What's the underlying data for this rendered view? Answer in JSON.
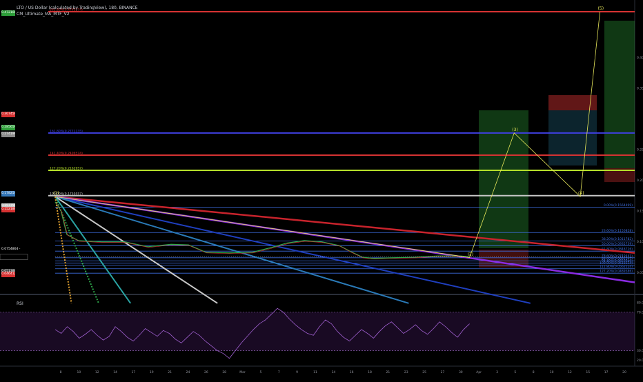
{
  "chart_header": {
    "symbol_line": "LTO / US Dollar (calculated by TradingView), 180, BINANCE",
    "indicator_line": "CM_Ultimate_MA_MTF_V2"
  },
  "rsi_pane": {
    "title": "RSI"
  },
  "price_badges": [
    {
      "text": "0.4721083",
      "color": "#2e9e3a",
      "y": 0.4721083
    },
    {
      "text": "0.3074595",
      "color": "#d63232",
      "y": 0.3074595
    },
    {
      "text": "0.2856595",
      "color": "#2e9e3a",
      "y": 0.2856595
    },
    {
      "text": "0.2741995",
      "color": "#8a8a8a",
      "y": 0.2741995
    },
    {
      "text": "0.1782549",
      "color": "#3577b8",
      "y": 0.1782549
    },
    {
      "text": "0.1577554",
      "color": "#c8c8c8",
      "y": 0.1577554
    },
    {
      "text": "0.1521864",
      "color": "#d63232",
      "y": 0.1521864
    },
    {
      "text": "0.0513867",
      "color": "#3a3a3a",
      "y": 0.0513867
    },
    {
      "text": "0.0464122",
      "color": "#d63232",
      "y": 0.0464122
    }
  ],
  "current_price_label": "0.0754864 -",
  "chart_data": [
    {
      "type": "line",
      "name": "price",
      "y_ticks": [
        "0.4000000",
        "0.3500000",
        "0.2500000",
        "0.2000000",
        "0.1500000",
        "0.1000000",
        "0.0500000"
      ],
      "y_tick_values": [
        0.4,
        0.35,
        0.25,
        0.2,
        0.15,
        0.1,
        0.05
      ],
      "x_ticks": [
        "8",
        "10",
        "12",
        "14",
        "17",
        "19",
        "21",
        "24",
        "26",
        "28",
        "Mar",
        "5",
        "7",
        "9",
        "11",
        "14",
        "16",
        "18",
        "21",
        "23",
        "25",
        "27",
        "30",
        "Apr",
        "3",
        "5",
        "8",
        "10",
        "12",
        "15",
        "17",
        "20"
      ],
      "ylim": [
        0.02,
        0.48
      ],
      "fib_levels": [
        {
          "label": "261.80%(0.4743274)",
          "value": 0.4743274,
          "color": "#d63232"
        },
        {
          "label": "161.80%(0.2771135)",
          "value": 0.2771135,
          "color": "#3f3fe0"
        },
        {
          "label": "141.40%(0.2409574)",
          "value": 0.2409574,
          "color": "#d63232"
        },
        {
          "label": "127.20%(0.2162957)",
          "value": 0.2162957,
          "color": "#b6e02a"
        },
        {
          "label": "100.00%(0.1750557)",
          "value": 0.1750557,
          "color": "#c8c8c8"
        },
        {
          "label": "0.00%(0.1564499)",
          "value": 0.1564499,
          "color": "#3e6ee0"
        },
        {
          "label": "23.60%(0.1150828)",
          "value": 0.1150828,
          "color": "#3e6ee0"
        },
        {
          "label": "38.20%(0.1011782)",
          "value": 0.1011782,
          "color": "#3e6ee0"
        },
        {
          "label": "50.00%(0.0935739)",
          "value": 0.0935739,
          "color": "#3e6ee0"
        },
        {
          "label": "61.80%(0.0848726)",
          "value": 0.0848726,
          "color": "#3e6ee0"
        },
        {
          "label": "78.60%(0.0740443)",
          "value": 0.0740443,
          "color": "#3e6ee0"
        },
        {
          "label": "88.60%(0.0691247)",
          "value": 0.0691247,
          "color": "#3e6ee0"
        },
        {
          "label": "94.40%(0.0653549)",
          "value": 0.0653549,
          "color": "#3e6ee0"
        },
        {
          "label": "100.00%(0.0618334)",
          "value": 0.0618334,
          "color": "#3e6ee0"
        },
        {
          "label": "111.80%(0.0562224)",
          "value": 0.0562224,
          "color": "#3e6ee0"
        },
        {
          "label": "127.20%(0.0489386)",
          "value": 0.0489386,
          "color": "#3e6ee0"
        }
      ],
      "wave_labels": [
        "(1)",
        "(2)",
        "(3)",
        "(4)",
        "(5)"
      ],
      "wave_points": [
        {
          "label": "(1)",
          "x": 0.0,
          "y": 0.1735
        },
        {
          "label": "(2)",
          "x": 0.715,
          "y": 0.0744
        },
        {
          "label": "(3)",
          "x": 0.792,
          "y": 0.2771
        },
        {
          "label": "(4)",
          "x": 0.906,
          "y": 0.1735
        },
        {
          "label": "(5)",
          "x": 0.94,
          "y": 0.4743
        }
      ],
      "price_series": {
        "x": [
          0.0,
          0.01,
          0.02,
          0.04,
          0.08,
          0.12,
          0.16,
          0.2,
          0.23,
          0.26,
          0.3,
          0.34,
          0.37,
          0.4,
          0.43,
          0.46,
          0.49,
          0.51,
          0.53,
          0.55,
          0.58,
          0.62,
          0.66,
          0.7,
          0.715
        ],
        "y": [
          0.165,
          0.15,
          0.112,
          0.102,
          0.1,
          0.1,
          0.092,
          0.096,
          0.095,
          0.083,
          0.082,
          0.083,
          0.09,
          0.098,
          0.102,
          0.1,
          0.094,
          0.084,
          0.075,
          0.073,
          0.074,
          0.075,
          0.077,
          0.077,
          0.0754
        ]
      },
      "trend_lines": [
        {
          "from": [
            0.0,
            0.1735
          ],
          "to": [
            1.0,
            0.082
          ],
          "color": "#c8232c"
        },
        {
          "from": [
            0.0,
            0.1735
          ],
          "to": [
            1.0,
            0.034
          ],
          "color": "#8a2be2"
        },
        {
          "from": [
            0.0,
            0.1735
          ],
          "to": [
            0.82,
            0.0
          ],
          "color": "#1f3fbf"
        },
        {
          "from": [
            0.0,
            0.1735
          ],
          "to": [
            0.61,
            0.0
          ],
          "color": "#2a7ab8"
        },
        {
          "from": [
            0.0,
            0.1735
          ],
          "to": [
            0.28,
            0.0
          ],
          "color": "#c8c8c8"
        },
        {
          "from": [
            0.0,
            0.1735
          ],
          "to": [
            0.13,
            0.0
          ],
          "color": "#2aa3a3"
        },
        {
          "from": [
            0.0,
            0.1735
          ],
          "to": [
            0.075,
            0.0
          ],
          "color": "#2ea84a"
        },
        {
          "from": [
            0.0,
            0.1735
          ],
          "to": [
            0.028,
            0.0
          ],
          "color": "#e0a030"
        }
      ]
    },
    {
      "type": "line",
      "name": "RSI",
      "y_ticks": [
        "80.00",
        "70.00",
        "30.00",
        "20.00"
      ],
      "y_tick_values": [
        80,
        70,
        30,
        20
      ],
      "ylim": [
        16,
        85
      ],
      "bands": [
        70,
        30
      ],
      "values": [
        52,
        48,
        55,
        50,
        43,
        47,
        52,
        46,
        41,
        45,
        55,
        50,
        44,
        40,
        46,
        53,
        49,
        45,
        51,
        48,
        42,
        38,
        44,
        50,
        46,
        40,
        35,
        30,
        27,
        22,
        30,
        38,
        45,
        52,
        58,
        62,
        68,
        74,
        70,
        63,
        57,
        52,
        48,
        46,
        55,
        62,
        58,
        50,
        44,
        40,
        46,
        52,
        48,
        43,
        50,
        56,
        60,
        54,
        48,
        52,
        57,
        51,
        47,
        53,
        60,
        55,
        49,
        44,
        52,
        58
      ]
    }
  ]
}
